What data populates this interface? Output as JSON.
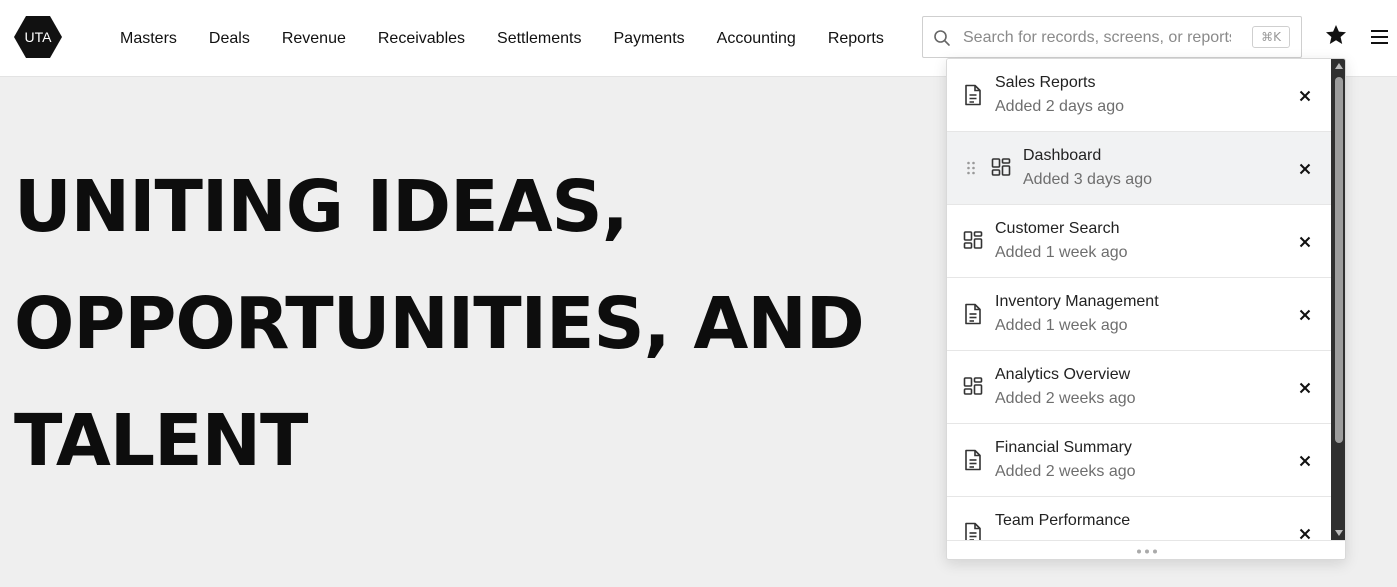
{
  "brand": {
    "logo_text": "UTA"
  },
  "nav": {
    "items": [
      "Masters",
      "Deals",
      "Revenue",
      "Receivables",
      "Settlements",
      "Payments",
      "Accounting",
      "Reports"
    ]
  },
  "search": {
    "placeholder": "Search for records, screens, or reports",
    "shortcut": "⌘K"
  },
  "hero": {
    "lines": [
      "UNITING IDEAS,",
      "OPPORTUNITIES, AND",
      "TALENT"
    ]
  },
  "favorites": {
    "items": [
      {
        "title": "Sales Reports",
        "added": "Added 2 days ago",
        "icon": "document-icon"
      },
      {
        "title": "Dashboard",
        "added": "Added 3 days ago",
        "icon": "dashboard-icon"
      },
      {
        "title": "Customer Search",
        "added": "Added 1 week ago",
        "icon": "dashboard-icon"
      },
      {
        "title": "Inventory Management",
        "added": "Added 1 week ago",
        "icon": "document-icon"
      },
      {
        "title": "Analytics Overview",
        "added": "Added 2 weeks ago",
        "icon": "dashboard-icon"
      },
      {
        "title": "Financial Summary",
        "added": "Added 2 weeks ago",
        "icon": "document-icon"
      },
      {
        "title": "Team Performance",
        "added": "",
        "icon": "document-icon"
      }
    ]
  },
  "colors": {
    "logo_bg": "#111111",
    "page_bg": "#efefef",
    "hover_row": "#f1f2f3",
    "scrollbar": "#2f2f2f"
  }
}
